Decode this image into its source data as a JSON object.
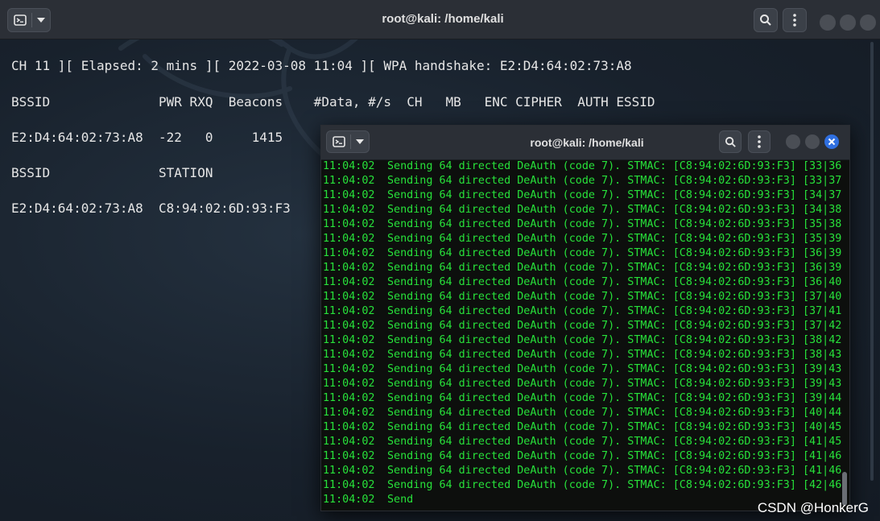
{
  "back_window": {
    "title": "root@kali: /home/kali",
    "status_line": "CH 11 ][ Elapsed: 2 mins ][ 2022-03-08 11:04 ][ WPA handshake: E2:D4:64:02:73:A8",
    "ap_header": "BSSID              PWR RXQ  Beacons    #Data, #/s  CH   MB   ENC CIPHER  AUTH ESSID",
    "ap_row": "E2:D4:64:02:73:A8  -22   0     1415",
    "station_header": "BSSID              STATION",
    "station_row": "E2:D4:64:02:73:A8  C8:94:02:6D:93:F3"
  },
  "front_window": {
    "title": "root@kali: /home/kali",
    "timestamp": "11:04:02",
    "lines": [
      "Sending 64 directed DeAuth (code 7). STMAC: [C8:94:02:6D:93:F3] [33|36",
      "Sending 64 directed DeAuth (code 7). STMAC: [C8:94:02:6D:93:F3] [33|37",
      "Sending 64 directed DeAuth (code 7). STMAC: [C8:94:02:6D:93:F3] [34|37",
      "Sending 64 directed DeAuth (code 7). STMAC: [C8:94:02:6D:93:F3] [34|38",
      "Sending 64 directed DeAuth (code 7). STMAC: [C8:94:02:6D:93:F3] [35|38",
      "Sending 64 directed DeAuth (code 7). STMAC: [C8:94:02:6D:93:F3] [35|39",
      "Sending 64 directed DeAuth (code 7). STMAC: [C8:94:02:6D:93:F3] [36|39",
      "Sending 64 directed DeAuth (code 7). STMAC: [C8:94:02:6D:93:F3] [36|39",
      "Sending 64 directed DeAuth (code 7). STMAC: [C8:94:02:6D:93:F3] [36|40",
      "Sending 64 directed DeAuth (code 7). STMAC: [C8:94:02:6D:93:F3] [37|40",
      "Sending 64 directed DeAuth (code 7). STMAC: [C8:94:02:6D:93:F3] [37|41",
      "Sending 64 directed DeAuth (code 7). STMAC: [C8:94:02:6D:93:F3] [37|42",
      "Sending 64 directed DeAuth (code 7). STMAC: [C8:94:02:6D:93:F3] [38|42",
      "Sending 64 directed DeAuth (code 7). STMAC: [C8:94:02:6D:93:F3] [38|43",
      "Sending 64 directed DeAuth (code 7). STMAC: [C8:94:02:6D:93:F3] [39|43",
      "Sending 64 directed DeAuth (code 7). STMAC: [C8:94:02:6D:93:F3] [39|43",
      "Sending 64 directed DeAuth (code 7). STMAC: [C8:94:02:6D:93:F3] [39|44",
      "Sending 64 directed DeAuth (code 7). STMAC: [C8:94:02:6D:93:F3] [40|44",
      "Sending 64 directed DeAuth (code 7). STMAC: [C8:94:02:6D:93:F3] [40|45",
      "Sending 64 directed DeAuth (code 7). STMAC: [C8:94:02:6D:93:F3] [41|45",
      "Sending 64 directed DeAuth (code 7). STMAC: [C8:94:02:6D:93:F3] [41|46",
      "Sending 64 directed DeAuth (code 7). STMAC: [C8:94:02:6D:93:F3] [41|46",
      "Sending 64 directed DeAuth (code 7). STMAC: [C8:94:02:6D:93:F3] [42|46",
      "Send"
    ],
    "text_color": "#27e13a",
    "close_color": "#2f6fe0"
  },
  "watermark_text": "CSDN @HonkerG",
  "icons": [
    "terminal-icon",
    "chevron-down-icon",
    "search-icon",
    "kebab-menu-icon",
    "close-icon",
    "kali-dragon-icon"
  ]
}
